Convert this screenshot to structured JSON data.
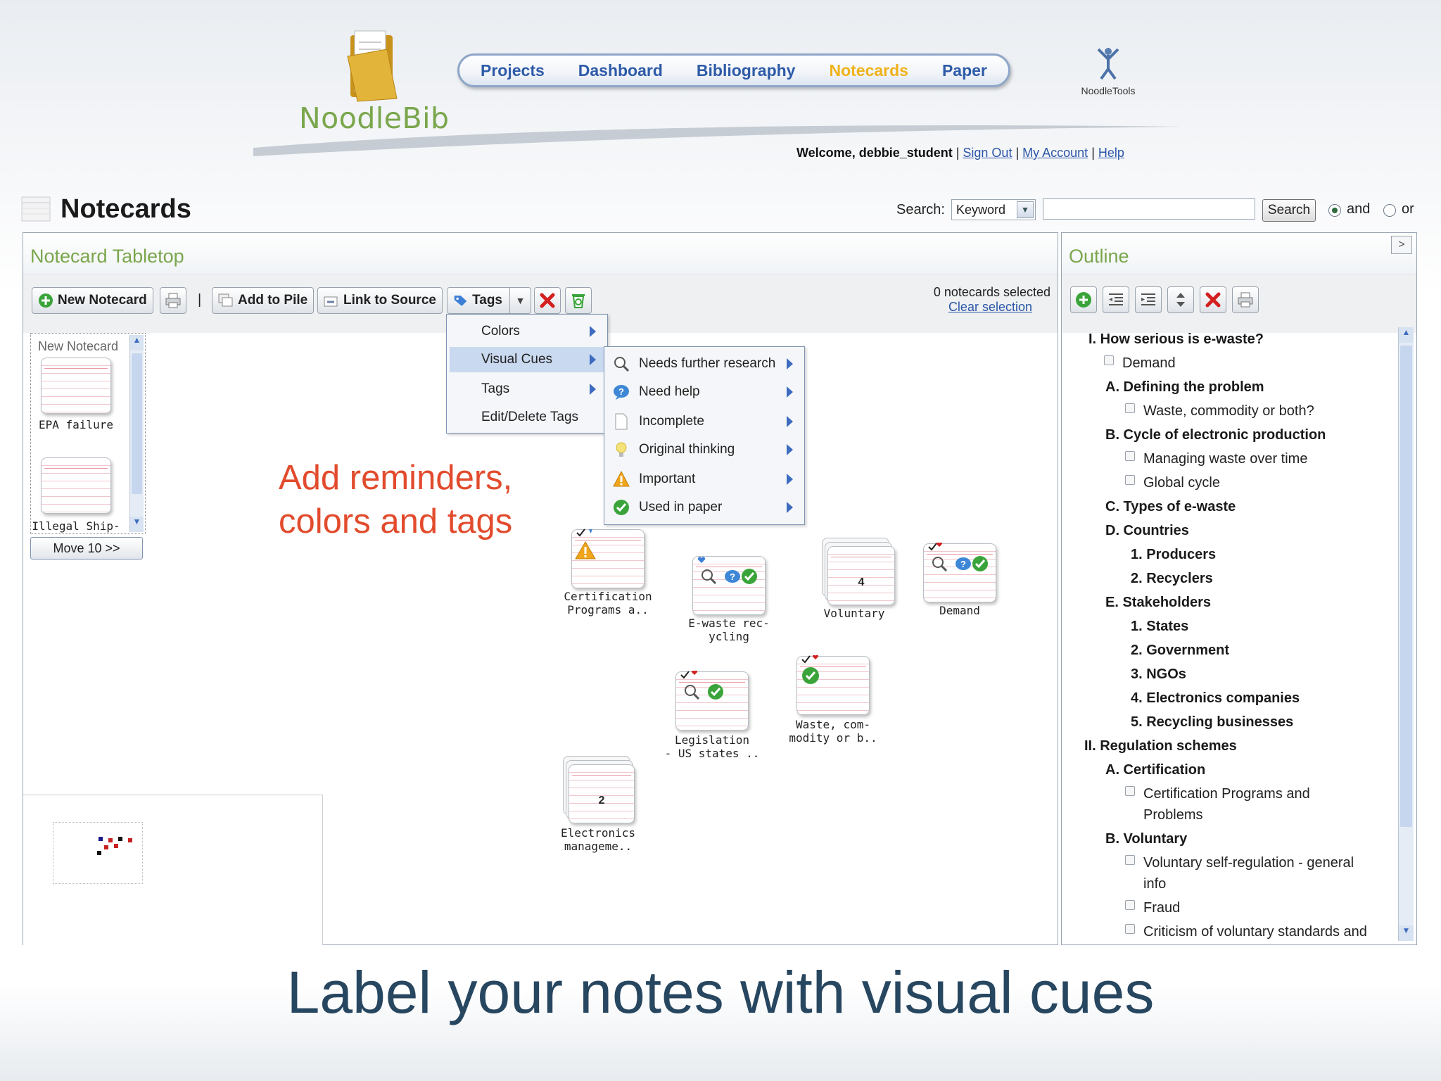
{
  "header": {
    "brand": "NoodleBib",
    "noodletools": "NoodleTools",
    "nav": [
      "Projects",
      "Dashboard",
      "Bibliography",
      "Notecards",
      "Paper"
    ],
    "active_nav": "Notecards",
    "welcome": "Welcome, debbie_student",
    "sign_out": "Sign Out",
    "my_account": "My Account",
    "help": "Help"
  },
  "page": {
    "title": "Notecards",
    "search_label": "Search:",
    "search_type": "Keyword",
    "search_value": "",
    "search_button": "Search",
    "radio_and": "and",
    "radio_or": "or"
  },
  "tabletop": {
    "title": "Notecard Tabletop",
    "new_notecard": "New Notecard",
    "add_to_pile": "Add to Pile",
    "link_to_source": "Link to Source",
    "tags": "Tags",
    "selected_count": "0 notecards selected",
    "clear_selection": "Clear selection",
    "pile_label": "New Notecard",
    "pile_cards": [
      "EPA failure",
      "Illegal Ship-"
    ],
    "move_button": "Move 10 >>"
  },
  "tags_menu": [
    "Colors",
    "Visual Cues",
    "Tags",
    "Edit/Delete Tags"
  ],
  "visual_cues_menu": [
    "Needs further research",
    "Need help",
    "Incomplete",
    "Original thinking",
    "Important",
    "Used in paper"
  ],
  "cards": [
    {
      "label": "Certification\nPrograms a.."
    },
    {
      "label": "E-waste rec-\nycling"
    },
    {
      "label": "Voluntary",
      "count": "4"
    },
    {
      "label": "Demand"
    },
    {
      "label": "Legislation\n- US states .."
    },
    {
      "label": "Waste, com-\nmodity or b.."
    },
    {
      "label": "Electronics\nmanageme..",
      "count": "2"
    }
  ],
  "outline": {
    "title": "Outline",
    "rows": [
      {
        "text": "I.  How serious is e-waste?",
        "kind": "h"
      },
      {
        "text": "Demand",
        "kind": "note"
      },
      {
        "text": "A.  Defining the problem",
        "kind": "h"
      },
      {
        "text": "Waste, commodity or both?",
        "kind": "note"
      },
      {
        "text": "B.  Cycle of electronic production",
        "kind": "h"
      },
      {
        "text": "Managing waste over time",
        "kind": "note"
      },
      {
        "text": "Global cycle",
        "kind": "note"
      },
      {
        "text": "C.  Types of e-waste",
        "kind": "h"
      },
      {
        "text": "D.  Countries",
        "kind": "h"
      },
      {
        "text": "1.  Producers",
        "kind": "h"
      },
      {
        "text": "2.  Recyclers",
        "kind": "h"
      },
      {
        "text": "E.  Stakeholders",
        "kind": "h"
      },
      {
        "text": "1.  States",
        "kind": "h"
      },
      {
        "text": "2.  Government",
        "kind": "h"
      },
      {
        "text": "3.  NGOs",
        "kind": "h"
      },
      {
        "text": "4.  Electronics companies",
        "kind": "h"
      },
      {
        "text": "5.  Recycling businesses",
        "kind": "h"
      },
      {
        "text": "II.  Regulation schemes",
        "kind": "h"
      },
      {
        "text": "A.  Certification",
        "kind": "h"
      },
      {
        "text": "Certification Programs and",
        "kind": "note"
      },
      {
        "text": "Problems",
        "kind": "cont"
      },
      {
        "text": "B.  Voluntary",
        "kind": "h"
      },
      {
        "text": "Voluntary self-regulation - general",
        "kind": "note"
      },
      {
        "text": "info",
        "kind": "cont"
      },
      {
        "text": "Fraud",
        "kind": "note"
      },
      {
        "text": "Criticism of voluntary standards and",
        "kind": "note"
      }
    ]
  },
  "annotation": {
    "line1": "Add reminders,",
    "line2": "colors and tags"
  },
  "caption": "Label your notes with visual cues",
  "colors": {
    "brand_green": "#7aa64c",
    "nav_blue": "#2e5ba8",
    "nav_active": "#f0b21a",
    "annotation_red": "#e24b2d",
    "caption_blue": "#274660"
  }
}
